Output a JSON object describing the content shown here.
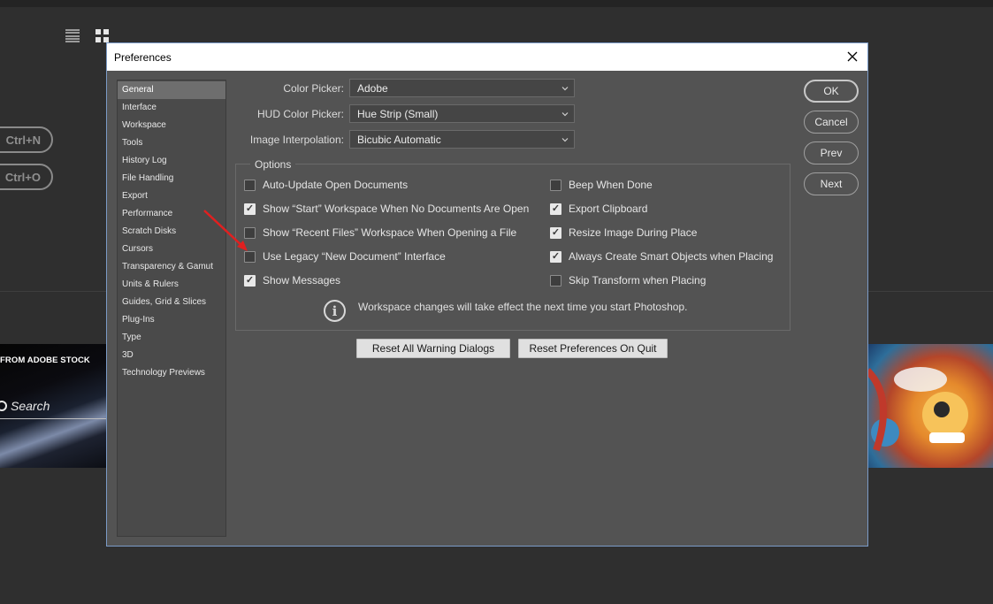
{
  "background": {
    "view_icons": [
      "list-view-icon",
      "grid-view-icon"
    ],
    "shortcuts": [
      "Ctrl+N",
      "Ctrl+O"
    ],
    "stock_banner_label": "FROM ADOBE STOCK",
    "stock_search_placeholder": "Search"
  },
  "dialog": {
    "title": "Preferences",
    "nav_items": [
      "General",
      "Interface",
      "Workspace",
      "Tools",
      "History Log",
      "File Handling",
      "Export",
      "Performance",
      "Scratch Disks",
      "Cursors",
      "Transparency & Gamut",
      "Units & Rulers",
      "Guides, Grid & Slices",
      "Plug-Ins",
      "Type",
      "3D",
      "Technology Previews"
    ],
    "selected_nav": "General",
    "fields": {
      "color_picker": {
        "label": "Color Picker:",
        "value": "Adobe"
      },
      "hud_color_picker": {
        "label": "HUD Color Picker:",
        "value": "Hue Strip (Small)"
      },
      "image_interpolation": {
        "label": "Image Interpolation:",
        "value": "Bicubic Automatic"
      }
    },
    "options_title": "Options",
    "options_left": [
      {
        "label": "Auto-Update Open Documents",
        "checked": false
      },
      {
        "label": "Show “Start” Workspace When No Documents Are Open",
        "checked": true
      },
      {
        "label": "Show “Recent Files” Workspace When Opening a File",
        "checked": false
      },
      {
        "label": "Use Legacy “New Document” Interface",
        "checked": false
      },
      {
        "label": "Show Messages",
        "checked": true
      }
    ],
    "options_right": [
      {
        "label": "Beep When Done",
        "checked": false
      },
      {
        "label": "Export Clipboard",
        "checked": true
      },
      {
        "label": "Resize Image During Place",
        "checked": true
      },
      {
        "label": "Always Create Smart Objects when Placing",
        "checked": true
      },
      {
        "label": "Skip Transform when Placing",
        "checked": false
      }
    ],
    "info_text": "Workspace changes will take effect the next time you start Photoshop.",
    "reset_warnings_label": "Reset All Warning Dialogs",
    "reset_prefs_label": "Reset Preferences On Quit",
    "buttons": {
      "ok": "OK",
      "cancel": "Cancel",
      "prev": "Prev",
      "next": "Next"
    }
  },
  "colors": {
    "dialog_bg": "#535353",
    "app_bg": "#2f2f2f",
    "arrow": "#e02020",
    "selected_nav": "#6e6e6e"
  }
}
